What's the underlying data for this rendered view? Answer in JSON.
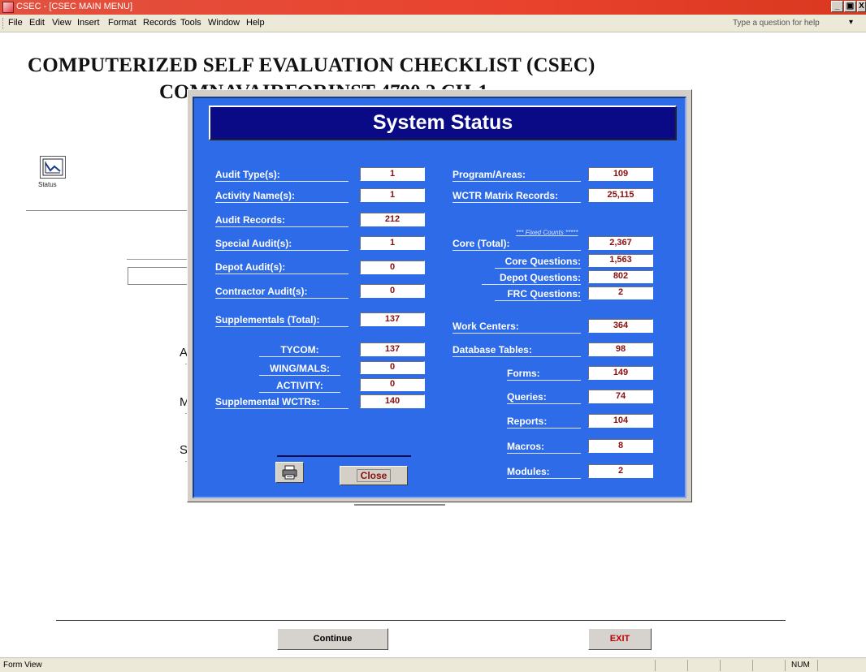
{
  "window": {
    "title": "CSEC - [CSEC MAIN MENU]",
    "min": "_",
    "restore": "▪",
    "close": "X"
  },
  "menu": {
    "items": [
      "File",
      "Edit",
      "View",
      "Insert",
      "Format",
      "Records",
      "Tools",
      "Window",
      "Help"
    ],
    "help_placeholder": "Type a question for help"
  },
  "page": {
    "title": "COMPUTERIZED SELF EVALUATION CHECKLIST  (CSEC)",
    "subtitle": "COMNAVAIRFORINST 4790.2 CH-1",
    "status_label": "Status",
    "bg_letters": [
      "A",
      "M",
      "S"
    ]
  },
  "dialog": {
    "header": "System Status",
    "left": [
      {
        "label": "Audit Type(s):",
        "value": "1"
      },
      {
        "label": "Activity Name(s):",
        "value": "1"
      },
      {
        "label": "Audit Records:",
        "value": "212"
      },
      {
        "label": "Special Audit(s):",
        "value": "1"
      },
      {
        "label": "Depot Audit(s):",
        "value": "0"
      },
      {
        "label": "Contractor Audit(s):",
        "value": "0"
      },
      {
        "label": "Supplementals (Total):",
        "value": "137"
      },
      {
        "label": "TYCOM:",
        "value": "137"
      },
      {
        "label": "WING/MALS:",
        "value": "0"
      },
      {
        "label": "ACTIVITY:",
        "value": "0"
      },
      {
        "label": "Supplemental WCTRs:",
        "value": "140"
      }
    ],
    "right": [
      {
        "label": "Program/Areas:",
        "value": "109"
      },
      {
        "label": "WCTR Matrix  Records:",
        "value": "25,115"
      },
      {
        "label": "Core (Total):",
        "value": "2,367"
      },
      {
        "label": "Core  Questions:",
        "value": "1,563"
      },
      {
        "label": "Depot  Questions:",
        "value": "802"
      },
      {
        "label": "FRC Questions:",
        "value": "2"
      },
      {
        "label": "Work Centers:",
        "value": "364"
      },
      {
        "label": "Database Tables:",
        "value": "98"
      },
      {
        "label": "Forms:",
        "value": "149"
      },
      {
        "label": "Queries:",
        "value": "74"
      },
      {
        "label": "Reports:",
        "value": "104"
      },
      {
        "label": "Macros:",
        "value": "8"
      },
      {
        "label": "Modules:",
        "value": "2"
      }
    ],
    "fixed_note": "*** Fixed Counts *****",
    "close_label": "Close"
  },
  "footer": {
    "continue_label": "Continue",
    "exit_label": "EXIT"
  },
  "statusbar": {
    "left": "Form View",
    "num": "NUM"
  }
}
